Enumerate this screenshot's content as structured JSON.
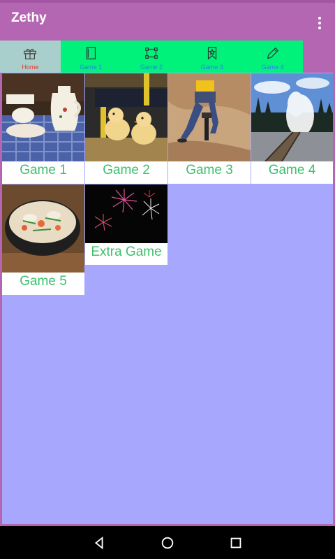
{
  "app": {
    "title": "Zethy"
  },
  "tabs": [
    {
      "label": "Home",
      "icon": "gift-icon",
      "active": true
    },
    {
      "label": "Game 1",
      "icon": "book-icon",
      "active": false
    },
    {
      "label": "Game 2",
      "icon": "crop-frame-icon",
      "active": false
    },
    {
      "label": "Game 3",
      "icon": "bookmark-star-icon",
      "active": false
    },
    {
      "label": "Game 4",
      "icon": "pencil-icon",
      "active": false
    }
  ],
  "games": [
    {
      "label": "Game 1",
      "image": "tea-set-photo"
    },
    {
      "label": "Game 2",
      "image": "chicks-photo"
    },
    {
      "label": "Game 3",
      "image": "worker-jackhammer-photo"
    },
    {
      "label": "Game 4",
      "image": "geyser-boardwalk-photo"
    },
    {
      "label": "Game 5",
      "image": "noodle-soup-photo"
    },
    {
      "label": "Extra Game",
      "image": "fireworks-photo"
    }
  ],
  "colors": {
    "appbar": "#b566b2",
    "tabbar": "#00f27a",
    "tab_active_bg": "#a9cfcc",
    "tab_active_text": "#e53935",
    "tab_text": "#2f7ff2",
    "content_bg": "#a7a8fd",
    "game_label": "#3cbf6c"
  },
  "navbar": {
    "buttons": [
      "back-icon",
      "home-circle-icon",
      "recents-icon"
    ]
  }
}
